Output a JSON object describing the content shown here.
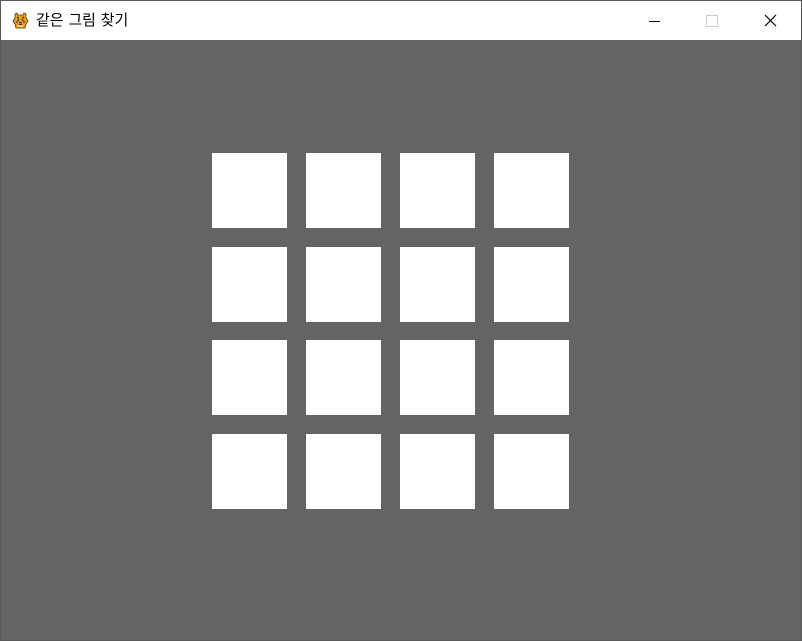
{
  "window": {
    "title": "같은 그림 찾기",
    "app_icon": "tiger-icon",
    "controls": {
      "minimize": "minimize-icon",
      "maximize": "maximize-icon",
      "close": "close-icon"
    }
  },
  "board": {
    "background_color": "#646464",
    "card_back_color": "#ffffff",
    "rows": 4,
    "columns": 4,
    "cards": [
      {
        "row": 1,
        "col": 1,
        "state": "face-down"
      },
      {
        "row": 1,
        "col": 2,
        "state": "face-down"
      },
      {
        "row": 1,
        "col": 3,
        "state": "face-down"
      },
      {
        "row": 1,
        "col": 4,
        "state": "face-down"
      },
      {
        "row": 2,
        "col": 1,
        "state": "face-down"
      },
      {
        "row": 2,
        "col": 2,
        "state": "face-down"
      },
      {
        "row": 2,
        "col": 3,
        "state": "face-down"
      },
      {
        "row": 2,
        "col": 4,
        "state": "face-down"
      },
      {
        "row": 3,
        "col": 1,
        "state": "face-down"
      },
      {
        "row": 3,
        "col": 2,
        "state": "face-down"
      },
      {
        "row": 3,
        "col": 3,
        "state": "face-down"
      },
      {
        "row": 3,
        "col": 4,
        "state": "face-down"
      },
      {
        "row": 4,
        "col": 1,
        "state": "face-down"
      },
      {
        "row": 4,
        "col": 2,
        "state": "face-down"
      },
      {
        "row": 4,
        "col": 3,
        "state": "face-down"
      },
      {
        "row": 4,
        "col": 4,
        "state": "face-down"
      }
    ]
  }
}
